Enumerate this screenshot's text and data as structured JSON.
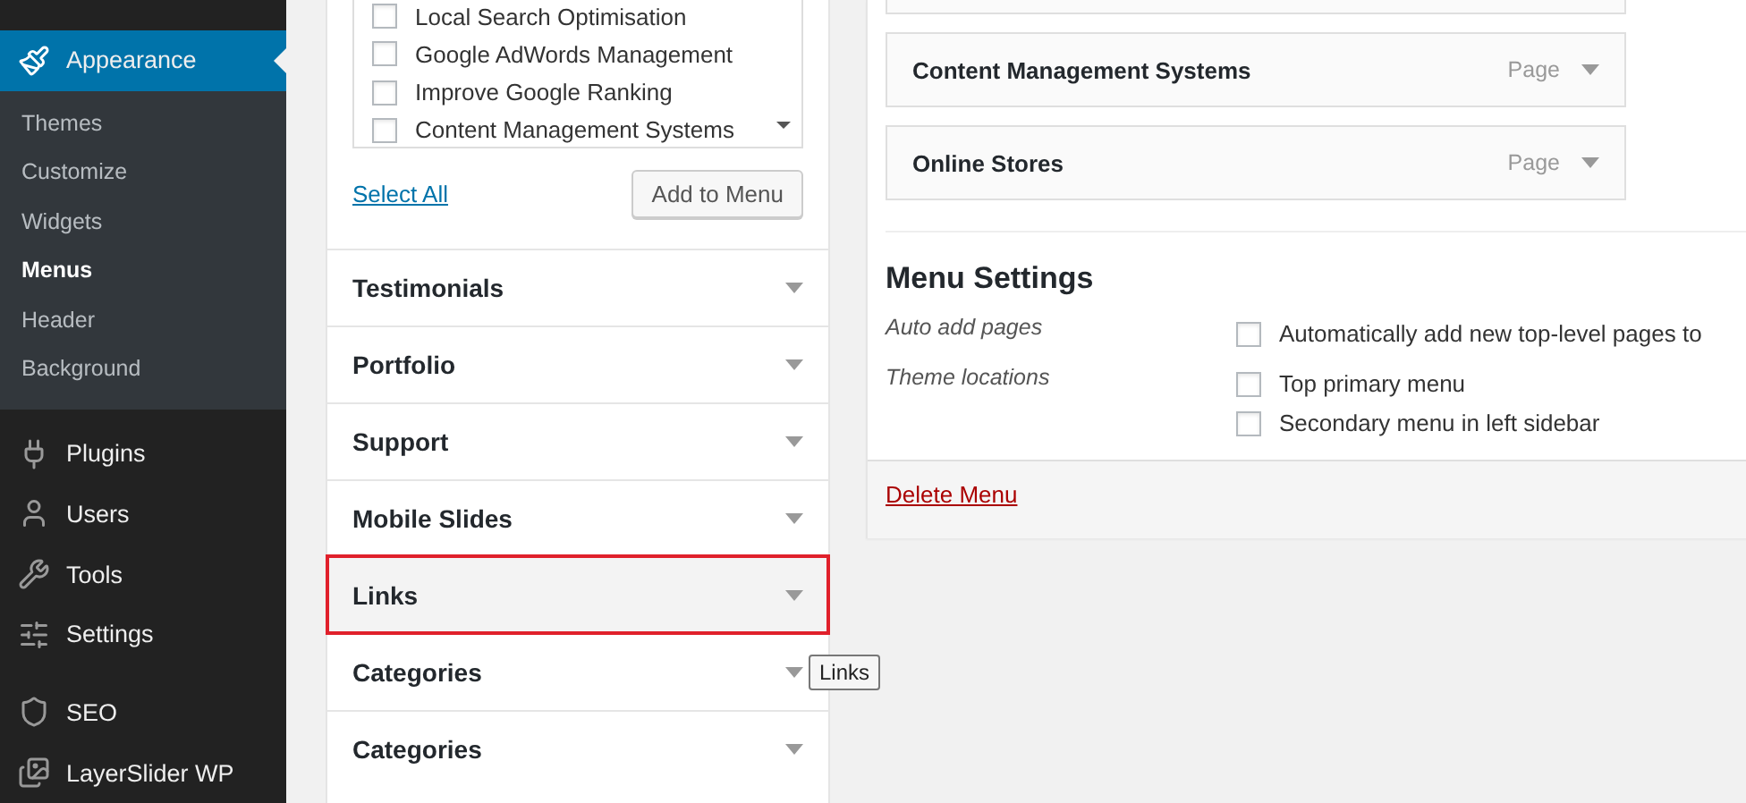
{
  "sidebar": {
    "items": [
      {
        "label": "Appearance",
        "selected": true,
        "expanded": true,
        "children": [
          {
            "label": "Themes",
            "selected": false
          },
          {
            "label": "Customize",
            "selected": false
          },
          {
            "label": "Widgets",
            "selected": false
          },
          {
            "label": "Menus",
            "selected": true
          },
          {
            "label": "Header",
            "selected": false
          },
          {
            "label": "Background",
            "selected": false
          }
        ]
      },
      {
        "label": "Plugins",
        "selected": false
      },
      {
        "label": "Users",
        "selected": false
      },
      {
        "label": "Tools",
        "selected": false
      },
      {
        "label": "Settings",
        "selected": false
      },
      {
        "label": "SEO",
        "selected": false
      },
      {
        "label": "LayerSlider WP",
        "selected": false
      }
    ]
  },
  "pages_box": {
    "items": [
      {
        "label": "Local Search Optimisation",
        "checked": false
      },
      {
        "label": "Google AdWords Management",
        "checked": false
      },
      {
        "label": "Improve Google Ranking",
        "checked": false
      },
      {
        "label": "Content Management Systems",
        "checked": false
      }
    ],
    "select_all": "Select All",
    "add_button": "Add to Menu"
  },
  "sections": [
    {
      "title": "Testimonials",
      "outlined": false
    },
    {
      "title": "Portfolio",
      "outlined": false
    },
    {
      "title": "Support",
      "outlined": false
    },
    {
      "title": "Mobile Slides",
      "outlined": false
    },
    {
      "title": "Links",
      "outlined": true
    },
    {
      "title": "Categories",
      "outlined": false
    },
    {
      "title": "Categories",
      "outlined": false
    }
  ],
  "tooltip": "Links",
  "menu_items": [
    {
      "title": "Content Management Systems",
      "type": "Page"
    },
    {
      "title": "Online Stores",
      "type": "Page"
    }
  ],
  "menu_settings": {
    "title": "Menu Settings",
    "rows": [
      {
        "label": "Auto add pages",
        "options": [
          {
            "label": "Automatically add new top-level pages to",
            "checked": false
          }
        ]
      },
      {
        "label": "Theme locations",
        "options": [
          {
            "label": "Top primary menu",
            "checked": false
          },
          {
            "label": "Secondary menu in left sidebar",
            "checked": false
          }
        ]
      }
    ]
  },
  "delete_link": "Delete Menu"
}
